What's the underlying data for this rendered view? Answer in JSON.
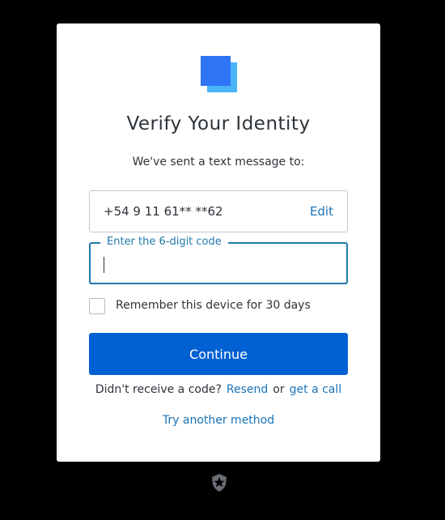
{
  "brand": {
    "logo_icon": "brand-cube-icon",
    "logo_colors": [
      "#2f75f6",
      "#5ed2fb",
      "#3a9bf8"
    ]
  },
  "heading": {
    "title": "Verify Your Identity",
    "subtitle": "We've sent a text message to:"
  },
  "phone": {
    "number": "+54 9 11 61** **62",
    "edit_label": "Edit"
  },
  "code_input": {
    "label": "Enter the 6-digit code",
    "value": ""
  },
  "remember": {
    "label": "Remember this device for 30 days",
    "checked": false
  },
  "actions": {
    "continue_label": "Continue",
    "resend_prompt": "Didn't receive a code?",
    "resend_label": "Resend",
    "or_label": "or",
    "call_label": "get a call",
    "try_another_label": "Try another method"
  },
  "footer": {
    "badge_icon": "auth0-shield-icon"
  },
  "colors": {
    "background": "#000000",
    "card": "#ffffff",
    "primary_button": "#0161d3",
    "link": "#1a73b8",
    "focus": "#1f79a9",
    "text": "#2d333a"
  }
}
